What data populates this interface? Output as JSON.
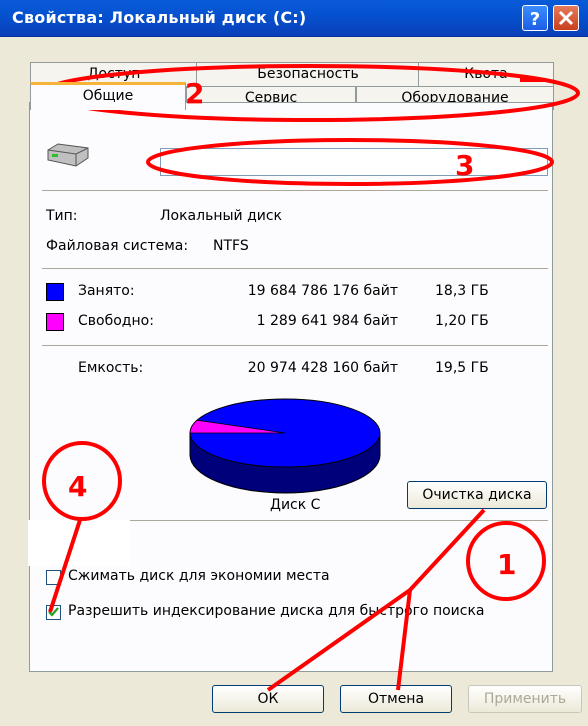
{
  "window": {
    "title": "Свойства: Локальный диск (C:)"
  },
  "tabs": {
    "row_back": [
      "Доступ",
      "Безопасность",
      "Квота"
    ],
    "row_front": [
      "Общие",
      "Сервис",
      "Оборудование"
    ],
    "active": "Общие"
  },
  "general": {
    "volume_label_value": "",
    "type_label": "Тип:",
    "type_value": "Локальный диск",
    "fs_label": "Файловая система:",
    "fs_value": "NTFS",
    "used": {
      "label": "Занято:",
      "bytes": "19 684 786 176 байт",
      "size": "18,3 ГБ",
      "color": "#0000ff"
    },
    "free": {
      "label": "Свободно:",
      "bytes": "1 289 641 984 байт",
      "size": "1,20 ГБ",
      "color": "#ff00ff"
    },
    "capacity": {
      "label": "Емкость:",
      "bytes": "20 974 428 160 байт",
      "size": "19,5 ГБ"
    },
    "disk_name": "Диск C",
    "cleanup_button": "Очистка диска",
    "compress_checkbox": {
      "label": "Сжимать диск для экономии места",
      "checked": false
    },
    "index_checkbox": {
      "label": "Разрешить индексирование диска для быстрого поиска",
      "checked": true
    },
    "pie": {
      "used_fraction": 0.9385,
      "free_fraction": 0.0615
    }
  },
  "buttons": {
    "ok": "ОК",
    "cancel": "Отмена",
    "apply": "Применить"
  },
  "annotations": [
    "1",
    "2",
    "3",
    "4"
  ],
  "colors": {
    "annotation_red": "#ff0000",
    "title_blue": "#0552d0"
  }
}
